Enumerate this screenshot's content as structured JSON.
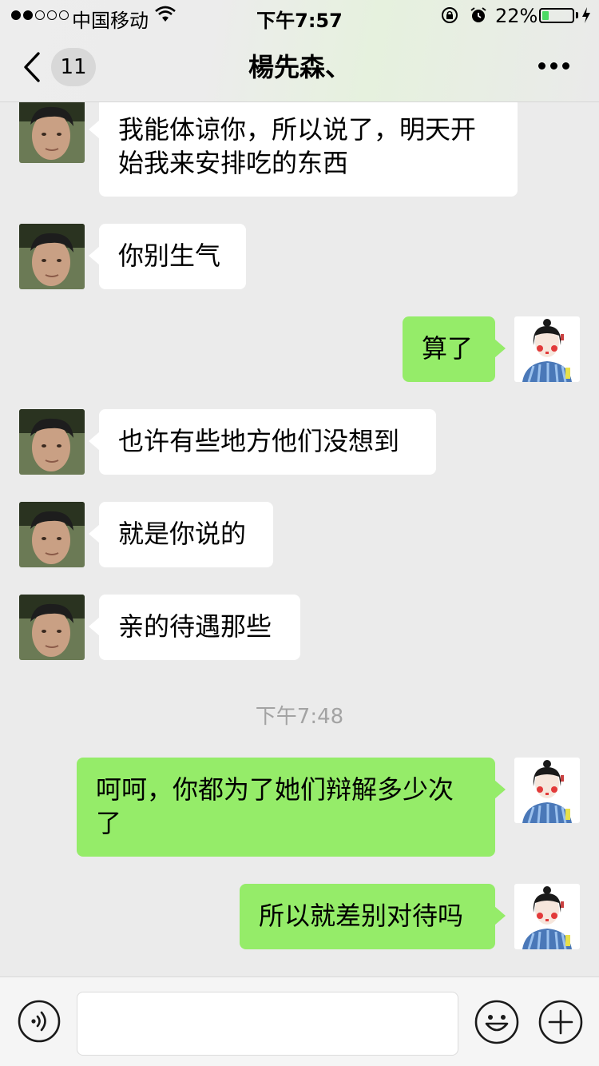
{
  "status_bar": {
    "carrier": "中国移动",
    "time": "下午7:57",
    "battery_percent": "22%",
    "battery_level": 0.22,
    "icons": [
      "signal-dots-icon",
      "wifi-icon",
      "orientation-lock-icon",
      "alarm-icon",
      "battery-icon",
      "charging-bolt-icon"
    ]
  },
  "nav": {
    "back_icon": "chevron-left-icon",
    "unread_count": "11",
    "title": "楊先森、",
    "more_icon": "more-dots-icon"
  },
  "messages": [
    {
      "side": "in",
      "text": "我能体谅你，所以说了，明天开\n始我来安排吃的东西"
    },
    {
      "side": "in",
      "text": "你别生气"
    },
    {
      "side": "out",
      "text": "算了"
    },
    {
      "side": "in",
      "text": "也许有些地方他们没想到"
    },
    {
      "side": "in",
      "text": "就是你说的"
    },
    {
      "side": "in",
      "text": "亲的待遇那些"
    },
    {
      "side": "out",
      "text": "呵呵，你都为了她们辩解多少次\n了"
    },
    {
      "side": "out",
      "text": "所以就差别对待吗"
    }
  ],
  "timestamp": "下午7:48",
  "input_bar": {
    "voice_icon": "voice-input-icon",
    "text_value": "",
    "emoji_icon": "emoji-icon",
    "plus_icon": "plus-icon"
  },
  "colors": {
    "background": "#ebebeb",
    "bubble_out": "#95ec69",
    "bubble_in": "#ffffff",
    "timestamp": "#a3a3a3",
    "battery_fill": "#4cd964"
  }
}
